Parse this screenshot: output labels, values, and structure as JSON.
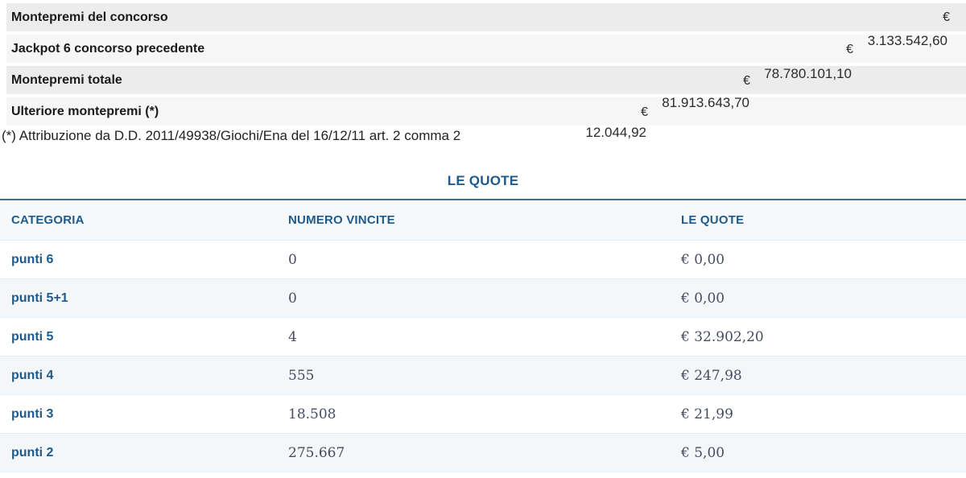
{
  "montepremi": {
    "rows": [
      {
        "label": "Montepremi del concorso",
        "currency": "€",
        "value": "3.133.542,60"
      },
      {
        "label": "Jackpot 6 concorso precedente",
        "currency": "€",
        "value": "78.780.101,10"
      },
      {
        "label": "Montepremi totale",
        "currency": "€",
        "value": "81.913.643,70"
      },
      {
        "label": "Ulteriore montepremi (*)",
        "currency": "€",
        "value": "12.044,92"
      }
    ],
    "footnote": "(*) Attribuzione da D.D. 2011/49938/Giochi/Ena del 16/12/11 art. 2 comma 2"
  },
  "quote_section": {
    "title": "LE QUOTE",
    "table": {
      "headers": [
        "CATEGORIA",
        "NUMERO VINCITE",
        "LE QUOTE"
      ],
      "rows": [
        {
          "categoria": "punti 6",
          "numero_vincite": "0",
          "quota": "€ 0,00"
        },
        {
          "categoria": "punti 5+1",
          "numero_vincite": "0",
          "quota": "€ 0,00"
        },
        {
          "categoria": "punti 5",
          "numero_vincite": "4",
          "quota": "€ 32.902,20"
        },
        {
          "categoria": "punti 4",
          "numero_vincite": "555",
          "quota": "€ 247,98"
        },
        {
          "categoria": "punti 3",
          "numero_vincite": "18.508",
          "quota": "€ 21,99"
        },
        {
          "categoria": "punti 2",
          "numero_vincite": "275.667",
          "quota": "€ 5,00"
        }
      ]
    }
  },
  "colors": {
    "stripe_dark": "#ececec",
    "stripe_light": "#f6f6f6",
    "accent_blue": "#1e5a8c",
    "table_top_border": "#3f6d92",
    "header_bg": "#f6f9fc",
    "alt_row_bg": "#f3f7fa",
    "serif_value_text": "#454d61"
  }
}
